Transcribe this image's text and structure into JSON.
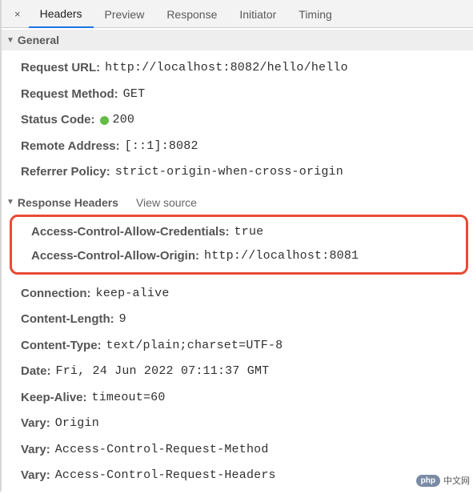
{
  "tabs": {
    "close": "×",
    "items": [
      "Headers",
      "Preview",
      "Response",
      "Initiator",
      "Timing"
    ],
    "activeIndex": 0
  },
  "sections": {
    "general": {
      "title": "General",
      "rows": [
        {
          "key": "Request URL:",
          "val": "http://localhost:8082/hello/hello"
        },
        {
          "key": "Request Method:",
          "val": "GET"
        },
        {
          "key": "Status Code:",
          "val": "200",
          "status": true
        },
        {
          "key": "Remote Address:",
          "val": "[::1]:8082"
        },
        {
          "key": "Referrer Policy:",
          "val": "strict-origin-when-cross-origin"
        }
      ]
    },
    "response": {
      "title": "Response Headers",
      "viewSource": "View source",
      "highlighted": [
        {
          "key": "Access-Control-Allow-Credentials:",
          "val": "true"
        },
        {
          "key": "Access-Control-Allow-Origin:",
          "val": "http://localhost:8081"
        }
      ],
      "rows": [
        {
          "key": "Connection:",
          "val": "keep-alive"
        },
        {
          "key": "Content-Length:",
          "val": "9"
        },
        {
          "key": "Content-Type:",
          "val": "text/plain;charset=UTF-8"
        },
        {
          "key": "Date:",
          "val": "Fri, 24 Jun 2022 07:11:37 GMT"
        },
        {
          "key": "Keep-Alive:",
          "val": "timeout=60"
        },
        {
          "key": "Vary:",
          "val": "Origin"
        },
        {
          "key": "Vary:",
          "val": "Access-Control-Request-Method"
        },
        {
          "key": "Vary:",
          "val": "Access-Control-Request-Headers"
        }
      ]
    }
  },
  "watermark": {
    "pill": "php",
    "text": "中文网"
  }
}
